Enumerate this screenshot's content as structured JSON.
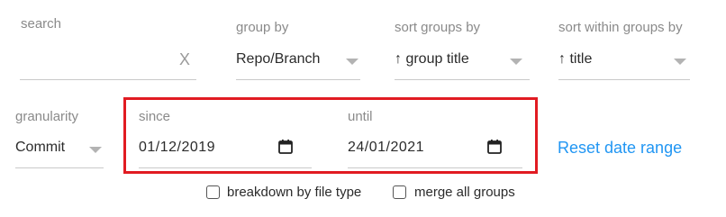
{
  "search": {
    "label": "search",
    "value": "",
    "clear_label": "X"
  },
  "group_by": {
    "label": "group by",
    "value": "Repo/Branch"
  },
  "sort_groups_by": {
    "label": "sort groups by",
    "value": "↑ group title"
  },
  "sort_within_groups_by": {
    "label": "sort within groups by",
    "value": "↑ title"
  },
  "granularity": {
    "label": "granularity",
    "value": "Commit"
  },
  "since": {
    "label": "since",
    "value": "01/12/2019"
  },
  "until": {
    "label": "until",
    "value": "24/01/2021"
  },
  "reset_date_range": {
    "label": "Reset date range"
  },
  "options": {
    "breakdown_by_file_type": {
      "label": "breakdown by file type",
      "checked": false
    },
    "merge_all_groups": {
      "label": "merge all groups",
      "checked": false
    }
  },
  "colors": {
    "highlight": "#e11b22",
    "link": "#2196f3"
  }
}
